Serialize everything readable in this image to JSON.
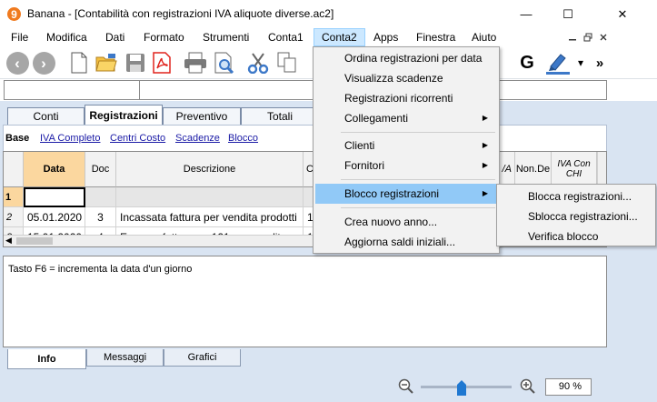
{
  "window": {
    "title": "Banana - [Contabilità con registrazioni IVA aliquote diverse.ac2]",
    "minimize_glyph": "—",
    "maximize_glyph": "☐",
    "close_glyph": "✕"
  },
  "menubar": {
    "items": [
      "File",
      "Modifica",
      "Dati",
      "Formato",
      "Strumenti",
      "Conta1",
      "Conta2",
      "Apps",
      "Finestra",
      "Aiuto"
    ],
    "active": "Conta2"
  },
  "toolbar": {
    "icons": [
      "back-icon",
      "forward-icon",
      "new-file-icon",
      "open-folder-icon",
      "save-icon",
      "pdf-icon",
      "print-icon",
      "print-preview-icon",
      "cut-icon",
      "copy-icon",
      "g-icon",
      "highlighter-icon",
      "overflow-chevron-icon"
    ],
    "back_glyph": "‹",
    "forward_glyph": "›",
    "g_label": "G",
    "overflow_glyph": "»"
  },
  "tabs": [
    {
      "label": "Conti",
      "active": false
    },
    {
      "label": "Registrazioni",
      "active": true
    },
    {
      "label": "Preventivo",
      "active": false
    },
    {
      "label": "Totali",
      "active": false
    }
  ],
  "views": [
    {
      "label": "Base",
      "active": true
    },
    {
      "label": "IVA Completo",
      "active": false
    },
    {
      "label": "Centri Costo",
      "active": false
    },
    {
      "label": "Scadenze",
      "active": false
    },
    {
      "label": "Blocco",
      "active": false
    }
  ],
  "table": {
    "headers": {
      "data": "Data",
      "doc": "Doc",
      "descrizione": "Descrizione",
      "c_partial": "C",
      "iva_partial": "/A",
      "nonded": "Non.De",
      "iva_contab": "IVA Con CHI"
    },
    "rows": [
      {
        "num": "1",
        "data": "",
        "doc": "",
        "descrizione": "",
        "c": ""
      },
      {
        "num": "2",
        "data": "05.01.2020",
        "doc": "3",
        "descrizione": "Incassata fattura per vendita prodotti",
        "c": "1"
      },
      {
        "num": "3",
        "data": "15.01.2020",
        "doc": "4",
        "descrizione": "Emessa fattura nr. 121 per vendita",
        "c": "1"
      }
    ]
  },
  "info": {
    "text": "Tasto F6 = incrementa la data d'un giorno"
  },
  "bottom_tabs": [
    {
      "label": "Info",
      "active": true
    },
    {
      "label": "Messaggi",
      "active": false
    },
    {
      "label": "Grafici",
      "active": false
    }
  ],
  "statusbar": {
    "zoom_value": "90",
    "zoom_unit": "%",
    "zoom_minus_glyph": "−",
    "zoom_plus_glyph": "+",
    "zoom_slider_level": 0.45
  },
  "conta2_menu": {
    "items": [
      {
        "label": "Ordina registrazioni per data",
        "submenu": false
      },
      {
        "label": "Visualizza scadenze",
        "submenu": false
      },
      {
        "label": "Registrazioni ricorrenti",
        "submenu": false
      },
      {
        "label": "Collegamenti",
        "submenu": true
      },
      {
        "label": "Clienti",
        "submenu": true
      },
      {
        "label": "Fornitori",
        "submenu": true
      },
      {
        "label": "Blocco registrazioni",
        "submenu": true,
        "highlighted": true
      },
      {
        "label": "Crea nuovo anno...",
        "submenu": false
      },
      {
        "label": "Aggiorna saldi iniziali...",
        "submenu": false
      }
    ],
    "submenu_arrow": "▶"
  },
  "blocco_submenu": {
    "items": [
      "Blocca registrazioni...",
      "Sblocca registrazioni...",
      "Verifica blocco"
    ]
  },
  "colors": {
    "accent_blue": "#3c78c8",
    "menu_highlight": "#91c9f7",
    "main_background": "#d9e4f2",
    "selected_header": "#fbd79f",
    "logo_orange": "#f07a1e",
    "pdf_red": "#e0231d"
  }
}
